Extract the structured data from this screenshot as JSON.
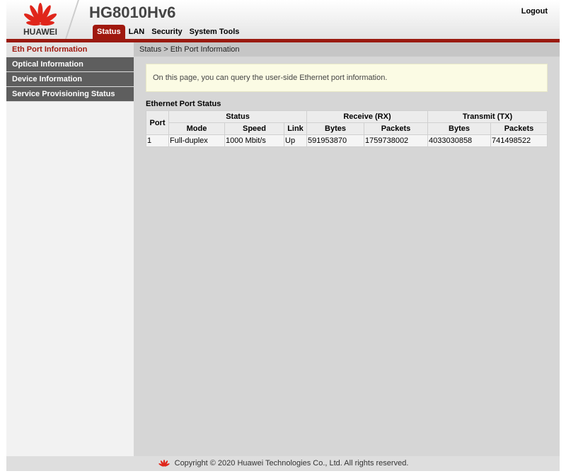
{
  "header": {
    "brand": "HUAWEI",
    "title": "HG8010Hv6",
    "logout": "Logout",
    "tabs": [
      {
        "label": "Status"
      },
      {
        "label": "LAN"
      },
      {
        "label": "Security"
      },
      {
        "label": "System Tools"
      }
    ]
  },
  "sidebar": {
    "items": [
      {
        "label": "Eth Port Information"
      },
      {
        "label": "Optical Information"
      },
      {
        "label": "Device Information"
      },
      {
        "label": "Service Provisioning Status"
      }
    ]
  },
  "main": {
    "breadcrumb": "Status > Eth Port Information",
    "info": "On this page, you can query the user-side Ethernet port information.",
    "section_title": "Ethernet Port Status",
    "table": {
      "groups": {
        "port": "Port",
        "status": "Status",
        "rx": "Receive (RX)",
        "tx": "Transmit (TX)"
      },
      "columns": [
        "Mode",
        "Speed",
        "Link",
        "Bytes",
        "Packets",
        "Bytes",
        "Packets"
      ],
      "rows": [
        [
          "1",
          "Full-duplex",
          "1000 Mbit/s",
          "Up",
          "591953870",
          "1759738002",
          "4033030858",
          "741498522"
        ]
      ]
    }
  },
  "footer": {
    "copyright": "Copyright © 2020 Huawei Technologies Co., Ltd. All rights reserved."
  },
  "colors": {
    "accent": "#a0180e",
    "sidebar_dark": "#5e5e5e",
    "main_bg": "#d6d6d6"
  }
}
